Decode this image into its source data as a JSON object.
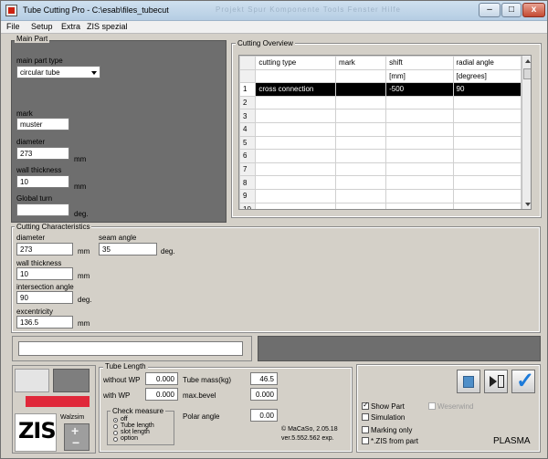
{
  "window": {
    "title": "Tube Cutting Pro - C:\\esab\\files_tubecut",
    "ghost_text": "Projekt   Spur   Komponente   Tools   Fenster   Hilfe"
  },
  "menu": [
    "File",
    "Setup",
    "Extra",
    "ZIS spezial"
  ],
  "main_part": {
    "group_title": "Main Part",
    "type_label": "main part type",
    "type_value": "circular tube",
    "mark_label": "mark",
    "mark_value": "muster",
    "diameter_label": "diameter",
    "diameter_value": "273",
    "diameter_unit": "mm",
    "wall_label": "wall thickness",
    "wall_value": "10",
    "wall_unit": "mm",
    "turn_label": "Global turn",
    "turn_value": "",
    "turn_unit": "deg."
  },
  "cutting_overview": {
    "group_title": "Cutting Overview",
    "headers": [
      "cutting type",
      "mark",
      "shift",
      "radial angle"
    ],
    "units": [
      "",
      "",
      "[mm]",
      "[degrees]"
    ],
    "rows": [
      [
        "1",
        "cross connection",
        "",
        "-500",
        "90"
      ],
      [
        "2",
        "",
        "",
        "",
        ""
      ],
      [
        "3",
        "",
        "",
        "",
        ""
      ],
      [
        "4",
        "",
        "",
        "",
        ""
      ],
      [
        "5",
        "",
        "",
        "",
        ""
      ],
      [
        "6",
        "",
        "",
        "",
        ""
      ],
      [
        "7",
        "",
        "",
        "",
        ""
      ],
      [
        "8",
        "",
        "",
        "",
        ""
      ],
      [
        "9",
        "",
        "",
        "",
        ""
      ],
      [
        "10",
        "",
        "",
        "",
        ""
      ]
    ]
  },
  "cutting_characteristics": {
    "group_title": "Cutting Characteristics",
    "diameter_label": "diameter",
    "diameter_value": "273",
    "diameter_unit": "mm",
    "seam_label": "seam angle",
    "seam_value": "35",
    "seam_unit": "deg.",
    "wall_label": "wall thickness",
    "wall_value": "10",
    "wall_unit": "mm",
    "intersection_label": "intersection angle",
    "intersection_value": "90",
    "intersection_unit": "deg.",
    "eccentricity_label": "excentricity",
    "eccentricity_value": "136.5",
    "eccentricity_unit": "mm"
  },
  "tube_length": {
    "group_title": "Tube Length",
    "without_wp_label": "without WP",
    "without_wp_value": "0.000",
    "with_wp_label": "with WP",
    "with_wp_value": "0.000",
    "mass_label": "Tube mass(kg)",
    "mass_value": "46.5",
    "max_bevel_label": "max.bevel",
    "max_bevel_value": "0.000",
    "polar_angle_label": "Polar angle",
    "polar_angle_value": "0.00",
    "check_measure_title": "Check measure",
    "check_options": [
      "off",
      "Tube length",
      "slot length",
      "option"
    ],
    "check_selected": 0,
    "copyright": "© MaCaSo, 2.05.18",
    "version": "ver.5.552.562 exp."
  },
  "logo": {
    "text": "ZIS",
    "walzsim_label": "Walzsim"
  },
  "options": {
    "show_part_label": "Show Part",
    "show_part_checked": true,
    "simulation_label": "Simulation",
    "simulation_checked": false,
    "marking_only_label": "Marking only",
    "marking_only_checked": false,
    "zis_from_part_label": "*.ZIS from part",
    "zis_from_part_checked": false,
    "weserwind_label": "Weserwind",
    "weserwind_checked": false,
    "mode_label": "PLASMA"
  },
  "colors": {
    "red_accent": "#e0283a",
    "accept_blue": "#1c7ad9",
    "dark_panel": "#6e6e6e"
  }
}
